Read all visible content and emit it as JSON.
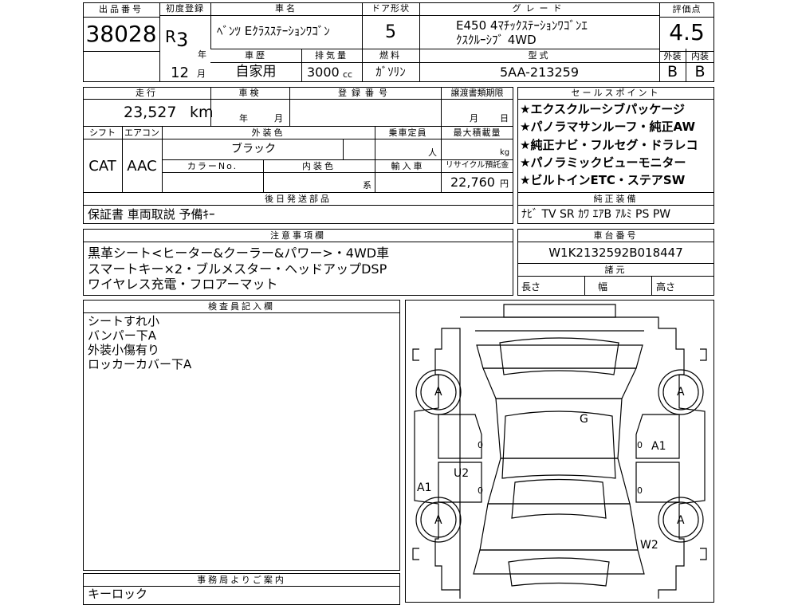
{
  "header": {
    "lot_label": "出品番号",
    "lot_no": "38028",
    "first_reg_label": "初度登録",
    "era": "R",
    "year": "3",
    "year_unit": "年",
    "month": "12",
    "month_unit": "月",
    "name_label": "車名",
    "name": "ﾍﾞﾝﾂ Eｸﾗｽｽﾃｰｼｮﾝﾜｺﾞﾝ",
    "door_label": "ドア形状",
    "door": "5",
    "grade_label": "グレード",
    "grade_line1": "E450 4ﾏﾁｯｸｽﾃｰｼｮﾝﾜｺﾞﾝｴ",
    "grade_line2": "ｸｽｸﾙｰｼﾌﾞ 4WD",
    "score_label": "評価点",
    "score": "4.5",
    "history_label": "車歴",
    "history": "自家用",
    "disp_label": "排気量",
    "disp": "3000",
    "disp_unit": "cc",
    "fuel_label": "燃料",
    "fuel": "ｶﾞｿﾘﾝ",
    "model_label": "型式",
    "model": "5AA-213259",
    "ext_label": "外装",
    "ext_grade": "B",
    "int_label": "内装",
    "int_grade": "B"
  },
  "info": {
    "mileage_label": "走行",
    "mileage": "23,527",
    "mileage_unit": "km",
    "inspection_label": "車検",
    "insp_year": "年",
    "insp_month": "月",
    "reg_no_label": "登録番号",
    "transfer_label": "譲渡書類期限",
    "transfer_month": "月",
    "transfer_day": "日",
    "shift_label": "シフト",
    "shift": "CAT",
    "ac_label": "エアコン",
    "ac": "AAC",
    "color_label": "外装色",
    "color": "ブラック",
    "color_no_label": "カラーNo.",
    "int_color_label": "内装色",
    "int_color_unit": "系",
    "capacity_label": "乗車定員",
    "capacity_unit": "人",
    "load_label": "最大積載量",
    "load_unit": "kg",
    "import_label": "輸入車",
    "recycle_label": "リサイクル預託金",
    "recycle": "22,760",
    "recycle_unit": "円",
    "later_label": "後日発送部品",
    "later": "保証書 車両取説 予備ｷｰ"
  },
  "sales": {
    "label": "セールスポイント",
    "points": [
      "★エクスクルーシブパッケージ",
      "★パノラマサンルーフ・純正AW",
      "★純正ナビ・フルセグ・ドラレコ",
      "★パノラミックビューモニター",
      "★ビルトインETC・ステアSW"
    ],
    "equip_label": "純正装備",
    "equip": "ﾅﾋﾞ TV SR ｶﾜ ｴｱB ｱﾙﾐ PS PW"
  },
  "notes": {
    "label": "注意事項欄",
    "lines": [
      "黒革シート<ヒーター&クーラー&パワー>・4WD車",
      "スマートキー×2・ブルメスター・ヘッドアップDSP",
      "ワイヤレス充電・フロアーマット"
    ]
  },
  "chassis": {
    "label": "車台番号",
    "vin": "W1K2132592B018447",
    "dims_label": "諸元",
    "length": "長さ",
    "width": "幅",
    "height": "高さ"
  },
  "inspector": {
    "label": "検査員記入欄",
    "lines": [
      "シートすれ小",
      "バンパー下A",
      "外装小傷有り",
      "ロッカーカバー下A"
    ]
  },
  "office": {
    "label": "事務局よりご案内",
    "text": "キーロック"
  },
  "diagram": {
    "marks": [
      "A",
      "A",
      "A",
      "A",
      "G",
      "A1",
      "A1",
      "U2",
      "W2"
    ],
    "zeros": [
      "0",
      "0",
      "0",
      "0"
    ]
  }
}
